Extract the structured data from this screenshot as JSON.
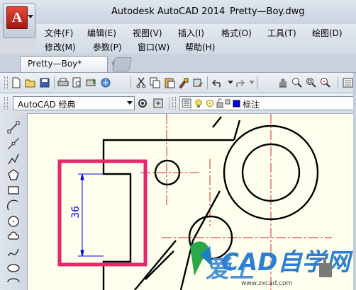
{
  "window": {
    "app_title": "Autodesk AutoCAD 2014",
    "file_title": "Pretty—Boy.dwg",
    "app_button_letter": "A"
  },
  "menu": {
    "row1": [
      "文件(F)",
      "编辑(E)",
      "视图(V)",
      "插入(I)",
      "格式(O)",
      "工具(T)",
      "绘图(D)"
    ],
    "row2": [
      "修改(M)",
      "参数(P)",
      "窗口(W)",
      "帮助(H)"
    ]
  },
  "tabs": {
    "document_tab": "Pretty—Boy*"
  },
  "toolbar": {
    "workspace": "AutoCAD 经典",
    "layer": "标注",
    "icons": [
      "new-icon",
      "open-icon",
      "save-icon",
      "print-icon",
      "plot-preview-icon",
      "publish-icon",
      "3d-print-icon",
      "cut-icon",
      "copy-icon",
      "paste-icon",
      "match-properties-icon",
      "block-editor-icon",
      "undo-icon",
      "redo-icon",
      "pan-icon",
      "zoom-realtime-icon",
      "zoom-window-icon",
      "zoom-previous-icon"
    ]
  },
  "draw_tools": [
    "line-icon",
    "construction-line-icon",
    "polyline-icon",
    "polygon-icon",
    "rectangle-icon",
    "arc-icon",
    "circle-icon",
    "revision-cloud-icon",
    "spline-icon",
    "ellipse-icon",
    "ellipse-arc-icon"
  ],
  "drawing": {
    "dimension_value": "36",
    "highlight_color": "#e8266a",
    "line_color": "#000000",
    "center_line_color": "#e02020",
    "dimension_color": "#0000ee"
  },
  "watermark": {
    "brand": "CAD自学网",
    "cn_text": "爱上",
    "url": "www.zxcad.com"
  },
  "colors": {
    "canvas_bg": "#ffffee",
    "chrome_bg": "#d6dbe3"
  }
}
